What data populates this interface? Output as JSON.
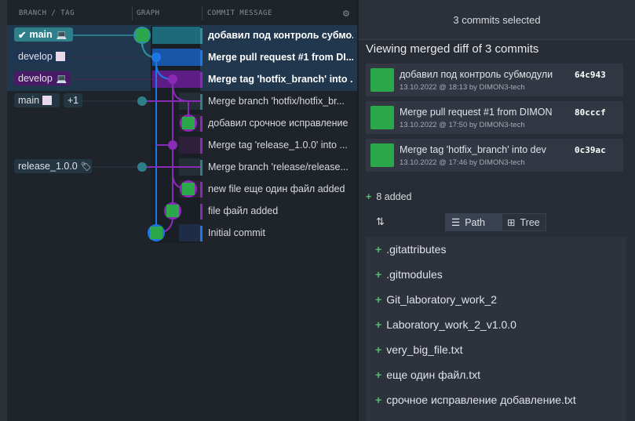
{
  "colors": {
    "accent": "#1d78e6",
    "purple": "#8a2bb8",
    "teal": "#2e7f8a",
    "green": "#2aa84a",
    "plus": "#4fc06a"
  },
  "left": {
    "headers": {
      "branch_tag": "BRANCH / TAG",
      "graph": "GRAPH",
      "commit_message": "COMMIT MESSAGE"
    },
    "rows": [
      {
        "pill": "main",
        "pill_icon": "check-icon",
        "pill_icon2": "laptop-icon",
        "message": "добавил под контроль субмо...",
        "selected": true
      },
      {
        "pill": "develop",
        "pill_icon2": "avatar-icon",
        "message": "Merge pull request #1 from DI...",
        "selected": true
      },
      {
        "pill": "develop",
        "pill_icon2": "laptop-icon",
        "message": "Merge tag 'hotfix_branch' into ...",
        "selected": true
      },
      {
        "pill": "main",
        "pill_icon2": "avatar-icon",
        "extra": "+1",
        "message": "Merge branch 'hotfix/hotfix_br...",
        "selected": false
      },
      {
        "message": "добавил срочное исправление",
        "selected": false
      },
      {
        "message": "Merge tag 'release_1.0.0' into ...",
        "selected": false
      },
      {
        "pill": "release_1.0.0",
        "pill_icon2": "tag-icon",
        "message": "Merge branch 'release/release...",
        "selected": false
      },
      {
        "message": "new file еще один файл added",
        "selected": false
      },
      {
        "message": "file файл added",
        "selected": false
      },
      {
        "message": "Initial commit",
        "selected": false
      }
    ]
  },
  "right": {
    "header": "3 commits selected",
    "title": "Viewing merged diff of 3 commits",
    "commits": [
      {
        "message": "добавил под контроль субмодули",
        "meta": "13.10.2022 @ 18:13 by DIMON3-tech",
        "sha": "64c943"
      },
      {
        "message": "Merge pull request #1 from DIMON",
        "meta": "13.10.2022 @ 17:50 by DIMON3-tech",
        "sha": "80cccf"
      },
      {
        "message": "Merge tag 'hotfix_branch' into dev",
        "meta": "13.10.2022 @ 17:46 by DIMON3-tech",
        "sha": "0c39ac"
      }
    ],
    "added_label": "8 added",
    "plus": "+",
    "view_path": "Path",
    "view_tree": "Tree",
    "files": [
      ".gitattributes",
      ".gitmodules",
      "Git_laboratory_work_2",
      "Laboratory_work_2_v1.0.0",
      "very_big_file.txt",
      "еще один файл.txt",
      "срочное исправление добавление.txt"
    ]
  }
}
